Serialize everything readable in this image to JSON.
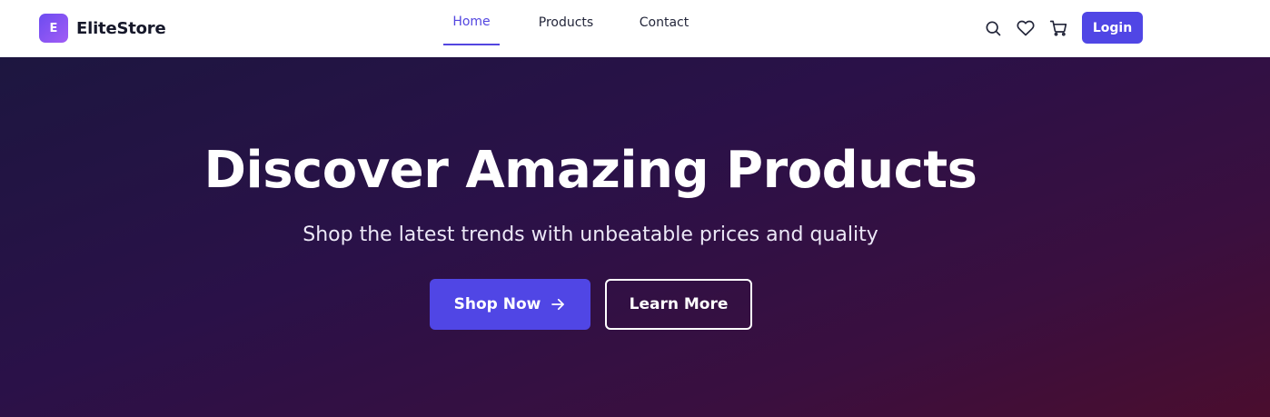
{
  "brand": {
    "logo_letter": "E",
    "name": "EliteStore"
  },
  "nav": {
    "items": [
      {
        "label": "Home",
        "active": true
      },
      {
        "label": "Products",
        "active": false
      },
      {
        "label": "Contact",
        "active": false
      }
    ]
  },
  "actions": {
    "icons": [
      "search-icon",
      "heart-icon",
      "cart-icon"
    ],
    "login_label": "Login"
  },
  "hero": {
    "title": "Discover Amazing Products",
    "subtitle": "Shop the latest trends with unbeatable prices and quality",
    "primary_cta": "Shop Now",
    "secondary_cta": "Learn More"
  },
  "colors": {
    "accent": "#5046e5",
    "hero_start": "#1d1640",
    "hero_end": "#4a0d2e",
    "text_dark": "#16182a"
  }
}
